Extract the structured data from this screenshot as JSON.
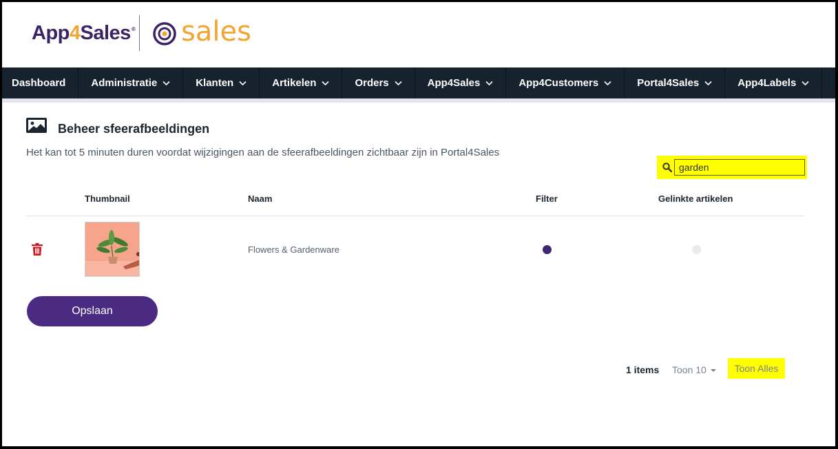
{
  "brand": {
    "app_name_part1": "App",
    "app_name_part2": "4",
    "app_name_part3": "Sales",
    "registered": "®",
    "product": "sales",
    "colors": {
      "purple": "#3b2466",
      "orange": "#f2a532",
      "nav_bg": "#16232e",
      "button": "#4b2b82"
    }
  },
  "nav": {
    "items": [
      {
        "label": "Dashboard",
        "dropdown": false
      },
      {
        "label": "Administratie",
        "dropdown": true
      },
      {
        "label": "Klanten",
        "dropdown": true
      },
      {
        "label": "Artikelen",
        "dropdown": true
      },
      {
        "label": "Orders",
        "dropdown": true
      },
      {
        "label": "App4Sales",
        "dropdown": true
      },
      {
        "label": "App4Customers",
        "dropdown": true
      },
      {
        "label": "Portal4Sales",
        "dropdown": true
      },
      {
        "label": "App4Labels",
        "dropdown": true
      }
    ]
  },
  "page": {
    "title_icon": "image-icon",
    "title": "Beheer sfeerafbeeldingen",
    "info": "Het kan tot 5 minuten duren voordat wijzigingen aan de sfeerafbeeldingen zichtbaar zijn in Portal4Sales"
  },
  "search": {
    "icon": "search-icon",
    "value": "garden"
  },
  "table": {
    "headers": {
      "thumbnail": "Thumbnail",
      "name": "Naam",
      "filter": "Filter",
      "linked": "Gelinkte artikelen"
    },
    "rows": [
      {
        "name": "Flowers & Gardenware",
        "filter": true,
        "linked": false
      }
    ]
  },
  "actions": {
    "save_label": "Opslaan"
  },
  "pagination": {
    "count": "1 items",
    "page_size": "Toon 10",
    "show_all": "Toon Alles"
  }
}
